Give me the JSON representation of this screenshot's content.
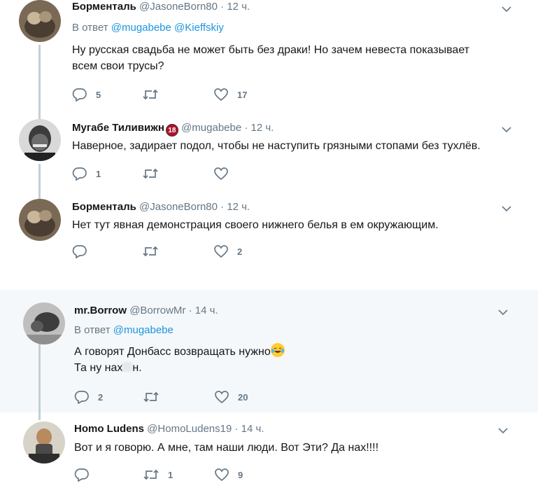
{
  "tweets": [
    {
      "name": "Борменталь",
      "handle": "@JasoneBorn80",
      "time": "12 ч.",
      "reply_prefix": "В ответ",
      "reply_to": "@mugabebe @Kieffskiy",
      "text_line1": "Ну русская свадьба не может быть без драки! Но зачем невеста показывает",
      "text_line2": "всем свои трусы?",
      "replies": "5",
      "retweets": "",
      "likes": "17"
    },
    {
      "name": "Мугабе Тиливижн",
      "badge": "18",
      "handle": "@mugabebe",
      "time": "12 ч.",
      "text_line1": "Наверное, задирает подол, чтобы не наступить грязными стопами без тухлёв.",
      "replies": "1",
      "retweets": "",
      "likes": ""
    },
    {
      "name": "Борменталь",
      "handle": "@JasoneBorn80",
      "time": "12 ч.",
      "text_line1": "Нет тут явная демонстрация своего нижнего белья в ем окружающим.",
      "replies": "",
      "retweets": "",
      "likes": "2"
    },
    {
      "name": "mr.Borrow",
      "handle": "@BorrowMr",
      "time": "14 ч.",
      "reply_prefix": "В ответ",
      "reply_to": "@mugabebe",
      "text_line1": "А говорят Донбасс возвращать нужно",
      "text_line2a": "Та ну нах",
      "text_line2b": "н.",
      "replies": "2",
      "retweets": "",
      "likes": "20"
    },
    {
      "name": "Homo Ludens",
      "handle": "@HomoLudens19",
      "time": "14 ч.",
      "text_line1": "Вот и я говорю. А мне, там наши люди. Вот Эти? Да нах!!!!",
      "replies": "",
      "retweets": "1",
      "likes": "9"
    }
  ],
  "separator": "·",
  "colors": {
    "name": "#14171a",
    "meta": "#657786",
    "link": "#1b95e0",
    "thread_line": "#c4cfd6",
    "band": "#f5f8fa"
  },
  "icons": [
    "reply-icon",
    "retweet-icon",
    "like-icon",
    "chevron-down-icon",
    "emoji-tears-of-joy-icon"
  ]
}
